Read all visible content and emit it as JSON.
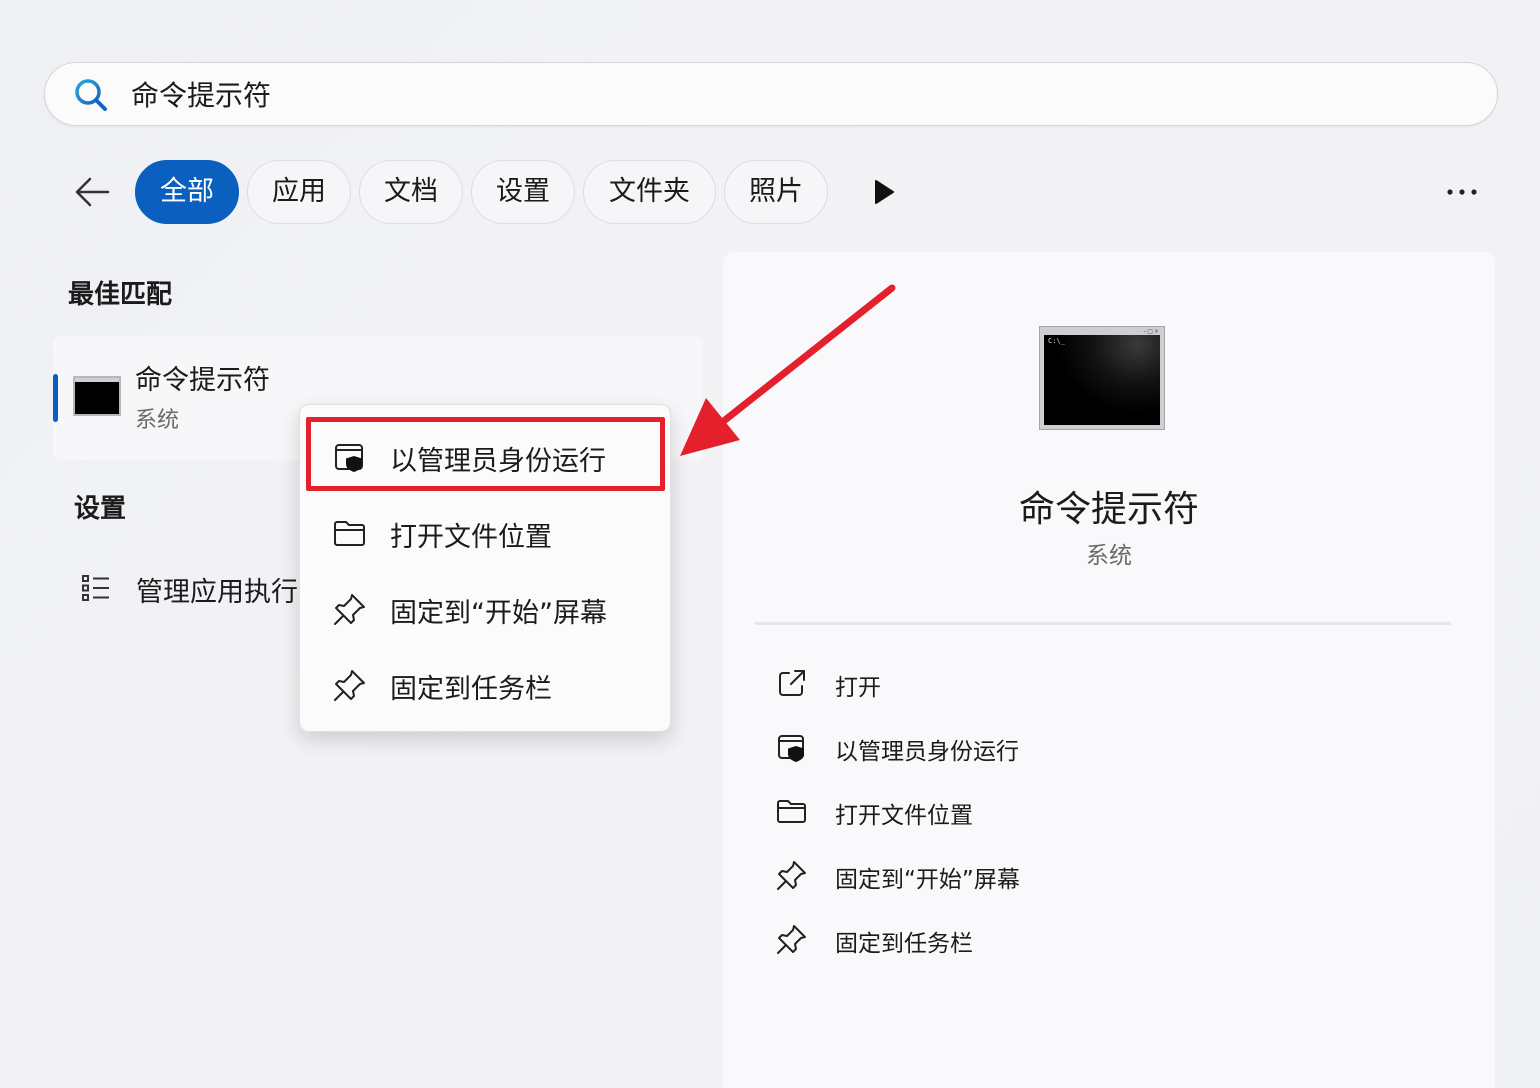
{
  "search": {
    "value": "命令提示符",
    "placeholder": ""
  },
  "filters": {
    "tabs": [
      {
        "label": "全部",
        "active": true
      },
      {
        "label": "应用",
        "active": false
      },
      {
        "label": "文档",
        "active": false
      },
      {
        "label": "设置",
        "active": false
      },
      {
        "label": "文件夹",
        "active": false
      },
      {
        "label": "照片",
        "active": false
      }
    ]
  },
  "left": {
    "best_match_title": "最佳匹配",
    "best_match": {
      "name": "命令提示符",
      "subtitle": "系统"
    },
    "settings_title": "设置",
    "settings_item": {
      "label": "管理应用执行别名"
    }
  },
  "context_menu": {
    "items": [
      {
        "label": "以管理员身份运行",
        "icon": "shield-admin-icon"
      },
      {
        "label": "打开文件位置",
        "icon": "folder-icon"
      },
      {
        "label": "固定到“开始”屏幕",
        "icon": "pin-icon"
      },
      {
        "label": "固定到任务栏",
        "icon": "pin-icon"
      }
    ]
  },
  "preview": {
    "title": "命令提示符",
    "subtitle": "系统",
    "prompt_text": "C:\\_",
    "actions": [
      {
        "label": "打开",
        "icon": "open-external-icon"
      },
      {
        "label": "以管理员身份运行",
        "icon": "shield-admin-icon"
      },
      {
        "label": "打开文件位置",
        "icon": "folder-icon"
      },
      {
        "label": "固定到“开始”屏幕",
        "icon": "pin-icon"
      },
      {
        "label": "固定到任务栏",
        "icon": "pin-icon"
      }
    ]
  },
  "colors": {
    "accent": "#0a5fbf",
    "annotation_red": "#e3202b"
  }
}
